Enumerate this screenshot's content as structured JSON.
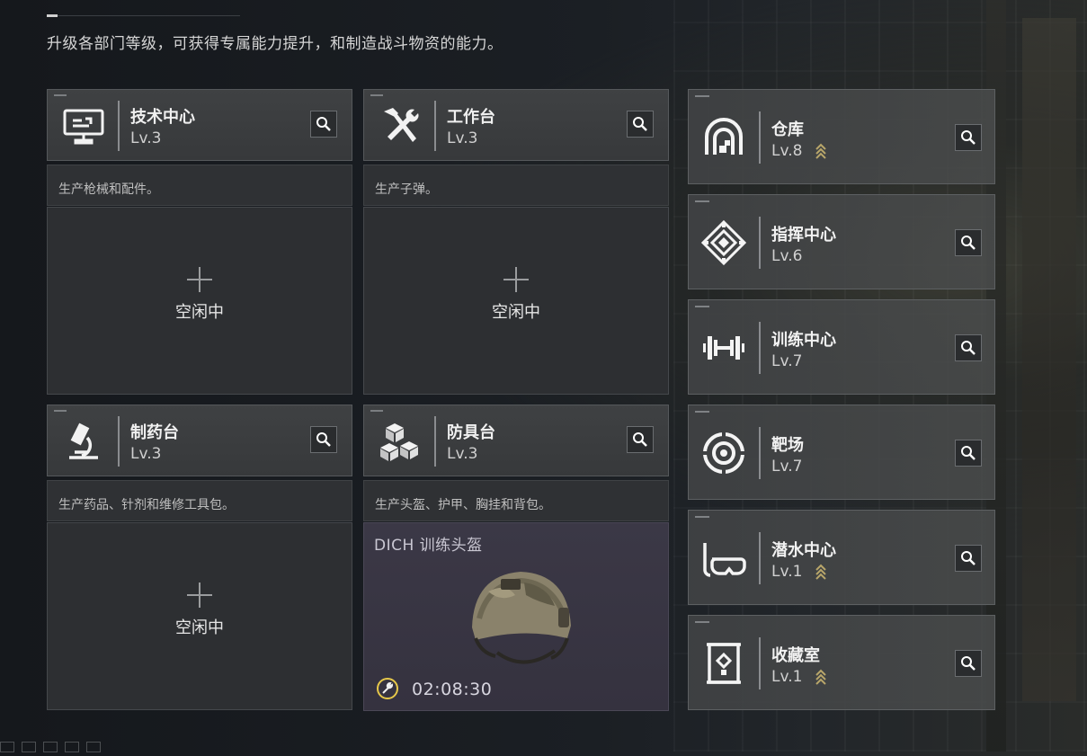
{
  "header": {
    "text": "升级各部门等级，可获得专属能力提升，和制造战斗物资的能力。"
  },
  "workshops": [
    {
      "name": "技术中心",
      "level": "Lv.3",
      "icon": "computer-icon",
      "desc": "生产枪械和配件。",
      "slot": {
        "state": "空闲中"
      }
    },
    {
      "name": "工作台",
      "level": "Lv.3",
      "icon": "hammer-wrench-icon",
      "desc": "生产子弹。",
      "slot": {
        "state": "空闲中"
      }
    },
    {
      "name": "制药台",
      "level": "Lv.3",
      "icon": "microscope-icon",
      "desc": "生产药品、针剂和维修工具包。",
      "slot": {
        "state": "空闲中"
      }
    },
    {
      "name": "防具台",
      "level": "Lv.3",
      "icon": "boxes-icon",
      "desc": "生产头盔、护甲、胸挂和背包。",
      "slot": {
        "item": "DICH 训练头盔",
        "timer": "02:08:30",
        "icon": "wrench-timer-icon"
      }
    }
  ],
  "facilities": [
    {
      "name": "仓库",
      "level": "Lv.8",
      "icon": "warehouse-icon",
      "upgrade": true
    },
    {
      "name": "指挥中心",
      "level": "Lv.6",
      "icon": "command-emblem-icon",
      "upgrade": false
    },
    {
      "name": "训练中心",
      "level": "Lv.7",
      "icon": "dumbbell-icon",
      "upgrade": false
    },
    {
      "name": "靶场",
      "level": "Lv.7",
      "icon": "target-icon",
      "upgrade": false
    },
    {
      "name": "潜水中心",
      "level": "Lv.1",
      "icon": "diving-mask-icon",
      "upgrade": true
    },
    {
      "name": "收藏室",
      "level": "Lv.1",
      "icon": "display-case-icon",
      "upgrade": true
    }
  ],
  "colors": {
    "upgrade_arrow": "#b8a66a",
    "timer_ring": "#e7c84a",
    "production_bg": "#3b3846"
  }
}
